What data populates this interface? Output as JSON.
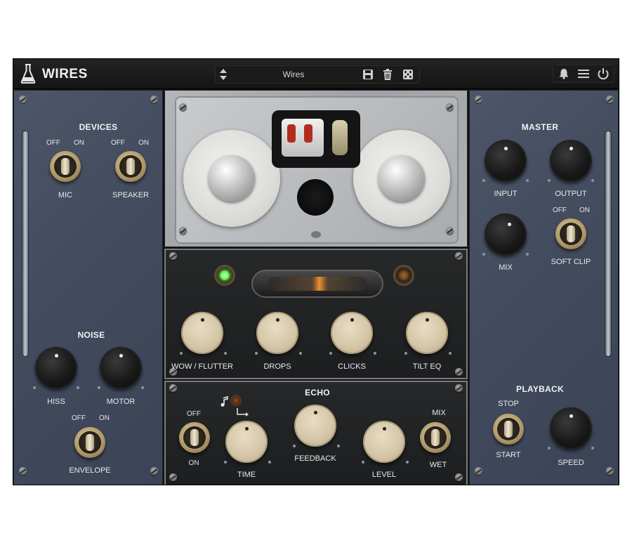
{
  "app": {
    "title": "WIRES"
  },
  "preset": {
    "name": "Wires"
  },
  "header_icons": {
    "left": [
      "flask-icon"
    ],
    "preset": [
      "up-down-arrows-icon",
      "save-icon",
      "trash-icon",
      "dice-icon"
    ],
    "right": [
      "bell-icon",
      "menu-icon",
      "power-icon"
    ]
  },
  "devices": {
    "title": "DEVICES",
    "mic": {
      "label": "MIC",
      "off": "OFF",
      "on": "ON"
    },
    "speaker": {
      "label": "SPEAKER",
      "off": "OFF",
      "on": "ON"
    }
  },
  "noise": {
    "title": "NOISE",
    "hiss": "HISS",
    "motor": "MOTOR",
    "envelope": {
      "label": "ENVELOPE",
      "off": "OFF",
      "on": "ON"
    }
  },
  "master": {
    "title": "MASTER",
    "input": "INPUT",
    "output": "OUTPUT",
    "mix": "MIX",
    "soft_clip": {
      "label": "SOFT CLIP",
      "off": "OFF",
      "on": "ON"
    }
  },
  "playback": {
    "title": "PLAYBACK",
    "stop": "STOP",
    "start": "START",
    "speed": "SPEED"
  },
  "character": {
    "wow_flutter": "WOW / FLUTTER",
    "drops": "DROPS",
    "clicks": "CLICKS",
    "tilt_eq": "TILT EQ"
  },
  "echo": {
    "title": "ECHO",
    "off": "OFF",
    "on": "ON",
    "time": "TIME",
    "feedback": "FEEDBACK",
    "level": "LEVEL",
    "mix": "MIX",
    "wet": "WET"
  },
  "colors": {
    "panel_blue": "#474f62",
    "knob_cream": "#d4c6a7",
    "led_green": "#6dff62",
    "tube_orange": "#ff9a2e"
  }
}
